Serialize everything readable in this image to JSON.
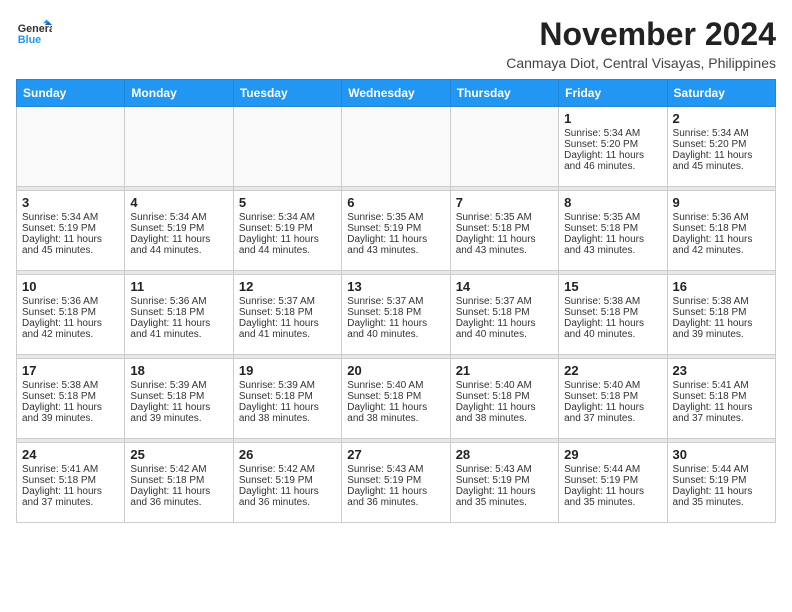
{
  "logo": {
    "line1": "General",
    "line2": "Blue"
  },
  "title": "November 2024",
  "location": "Canmaya Diot, Central Visayas, Philippines",
  "days_of_week": [
    "Sunday",
    "Monday",
    "Tuesday",
    "Wednesday",
    "Thursday",
    "Friday",
    "Saturday"
  ],
  "weeks": [
    [
      {
        "day": "",
        "info": ""
      },
      {
        "day": "",
        "info": ""
      },
      {
        "day": "",
        "info": ""
      },
      {
        "day": "",
        "info": ""
      },
      {
        "day": "",
        "info": ""
      },
      {
        "day": "1",
        "info": "Sunrise: 5:34 AM\nSunset: 5:20 PM\nDaylight: 11 hours and 46 minutes."
      },
      {
        "day": "2",
        "info": "Sunrise: 5:34 AM\nSunset: 5:20 PM\nDaylight: 11 hours and 45 minutes."
      }
    ],
    [
      {
        "day": "3",
        "info": "Sunrise: 5:34 AM\nSunset: 5:19 PM\nDaylight: 11 hours and 45 minutes."
      },
      {
        "day": "4",
        "info": "Sunrise: 5:34 AM\nSunset: 5:19 PM\nDaylight: 11 hours and 44 minutes."
      },
      {
        "day": "5",
        "info": "Sunrise: 5:34 AM\nSunset: 5:19 PM\nDaylight: 11 hours and 44 minutes."
      },
      {
        "day": "6",
        "info": "Sunrise: 5:35 AM\nSunset: 5:19 PM\nDaylight: 11 hours and 43 minutes."
      },
      {
        "day": "7",
        "info": "Sunrise: 5:35 AM\nSunset: 5:18 PM\nDaylight: 11 hours and 43 minutes."
      },
      {
        "day": "8",
        "info": "Sunrise: 5:35 AM\nSunset: 5:18 PM\nDaylight: 11 hours and 43 minutes."
      },
      {
        "day": "9",
        "info": "Sunrise: 5:36 AM\nSunset: 5:18 PM\nDaylight: 11 hours and 42 minutes."
      }
    ],
    [
      {
        "day": "10",
        "info": "Sunrise: 5:36 AM\nSunset: 5:18 PM\nDaylight: 11 hours and 42 minutes."
      },
      {
        "day": "11",
        "info": "Sunrise: 5:36 AM\nSunset: 5:18 PM\nDaylight: 11 hours and 41 minutes."
      },
      {
        "day": "12",
        "info": "Sunrise: 5:37 AM\nSunset: 5:18 PM\nDaylight: 11 hours and 41 minutes."
      },
      {
        "day": "13",
        "info": "Sunrise: 5:37 AM\nSunset: 5:18 PM\nDaylight: 11 hours and 40 minutes."
      },
      {
        "day": "14",
        "info": "Sunrise: 5:37 AM\nSunset: 5:18 PM\nDaylight: 11 hours and 40 minutes."
      },
      {
        "day": "15",
        "info": "Sunrise: 5:38 AM\nSunset: 5:18 PM\nDaylight: 11 hours and 40 minutes."
      },
      {
        "day": "16",
        "info": "Sunrise: 5:38 AM\nSunset: 5:18 PM\nDaylight: 11 hours and 39 minutes."
      }
    ],
    [
      {
        "day": "17",
        "info": "Sunrise: 5:38 AM\nSunset: 5:18 PM\nDaylight: 11 hours and 39 minutes."
      },
      {
        "day": "18",
        "info": "Sunrise: 5:39 AM\nSunset: 5:18 PM\nDaylight: 11 hours and 39 minutes."
      },
      {
        "day": "19",
        "info": "Sunrise: 5:39 AM\nSunset: 5:18 PM\nDaylight: 11 hours and 38 minutes."
      },
      {
        "day": "20",
        "info": "Sunrise: 5:40 AM\nSunset: 5:18 PM\nDaylight: 11 hours and 38 minutes."
      },
      {
        "day": "21",
        "info": "Sunrise: 5:40 AM\nSunset: 5:18 PM\nDaylight: 11 hours and 38 minutes."
      },
      {
        "day": "22",
        "info": "Sunrise: 5:40 AM\nSunset: 5:18 PM\nDaylight: 11 hours and 37 minutes."
      },
      {
        "day": "23",
        "info": "Sunrise: 5:41 AM\nSunset: 5:18 PM\nDaylight: 11 hours and 37 minutes."
      }
    ],
    [
      {
        "day": "24",
        "info": "Sunrise: 5:41 AM\nSunset: 5:18 PM\nDaylight: 11 hours and 37 minutes."
      },
      {
        "day": "25",
        "info": "Sunrise: 5:42 AM\nSunset: 5:18 PM\nDaylight: 11 hours and 36 minutes."
      },
      {
        "day": "26",
        "info": "Sunrise: 5:42 AM\nSunset: 5:19 PM\nDaylight: 11 hours and 36 minutes."
      },
      {
        "day": "27",
        "info": "Sunrise: 5:43 AM\nSunset: 5:19 PM\nDaylight: 11 hours and 36 minutes."
      },
      {
        "day": "28",
        "info": "Sunrise: 5:43 AM\nSunset: 5:19 PM\nDaylight: 11 hours and 35 minutes."
      },
      {
        "day": "29",
        "info": "Sunrise: 5:44 AM\nSunset: 5:19 PM\nDaylight: 11 hours and 35 minutes."
      },
      {
        "day": "30",
        "info": "Sunrise: 5:44 AM\nSunset: 5:19 PM\nDaylight: 11 hours and 35 minutes."
      }
    ]
  ]
}
